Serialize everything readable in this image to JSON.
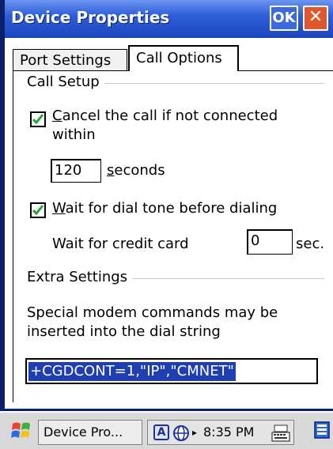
{
  "window": {
    "title": "Device Properties",
    "ok_label": "OK",
    "close_glyph": "✕"
  },
  "tabs": [
    {
      "label": "Port Settings",
      "selected": false
    },
    {
      "label": "Call Options",
      "selected": true
    }
  ],
  "call_setup": {
    "group_label": "Call Setup",
    "cancel_checked": true,
    "cancel_label_first": "C",
    "cancel_label_rest": "ancel the call if not connected",
    "cancel_label_line2": "within",
    "timeout_value": "120",
    "seconds_first": "s",
    "seconds_rest": "econds",
    "wait_checked": true,
    "wait_label_first": "W",
    "wait_label_rest": "ait for dial tone before dialing",
    "credit_label": "Wait for credit card",
    "credit_value": "0",
    "credit_unit": "sec."
  },
  "extra_settings": {
    "group_label": "Extra Settings",
    "description_line1": "Special modem commands may be",
    "description_line2": "inserted into the dial string",
    "command_value": "+CGDCONT=1,\"IP\",\"CMNET\""
  },
  "taskbar": {
    "task_label": "Device Pro...",
    "tray_a": "A",
    "tray_arrow": "▸",
    "time": "8:35 PM"
  },
  "colors": {
    "titlebar": "#2f5fd8",
    "close_button": "#e2562c",
    "selection": "#1f3fb0",
    "check": "#2a9d3a"
  }
}
